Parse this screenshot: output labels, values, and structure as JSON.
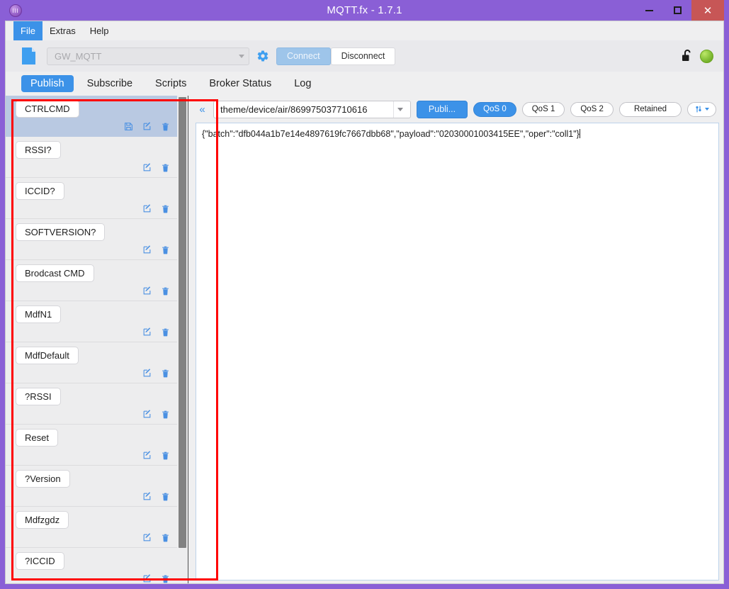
{
  "window": {
    "title": "MQTT.fx - 1.7.1",
    "app_icon": "mqtt-globe-icon",
    "controls": {
      "minimize": "minimize-icon",
      "maximize": "maximize-icon",
      "close": "✕"
    }
  },
  "menubar": {
    "items": [
      {
        "label": "File",
        "active": true
      },
      {
        "label": "Extras",
        "active": false
      },
      {
        "label": "Help",
        "active": false
      }
    ]
  },
  "connection_toolbar": {
    "doc_icon": "new-file-icon",
    "broker_profile": "GW_MQTT",
    "gear_icon": "settings-gear-icon",
    "connect_label": "Connect",
    "disconnect_label": "Disconnect",
    "lock_icon": "unlocked-padlock-icon",
    "status_led": "connected-green-led",
    "led_color": "#8cc63f"
  },
  "tabs": [
    {
      "label": "Publish",
      "active": true
    },
    {
      "label": "Subscribe",
      "active": false
    },
    {
      "label": "Scripts",
      "active": false
    },
    {
      "label": "Broker Status",
      "active": false
    },
    {
      "label": "Log",
      "active": false
    }
  ],
  "command_list": {
    "items": [
      {
        "label": "CTRLCMD",
        "selected": true,
        "has_save": true
      },
      {
        "label": "RSSI?",
        "selected": false,
        "has_save": false
      },
      {
        "label": "ICCID?",
        "selected": false,
        "has_save": false
      },
      {
        "label": "SOFTVERSION?",
        "selected": false,
        "has_save": false
      },
      {
        "label": "Brodcast CMD",
        "selected": false,
        "has_save": false
      },
      {
        "label": "MdfN1",
        "selected": false,
        "has_save": false
      },
      {
        "label": "MdfDefault",
        "selected": false,
        "has_save": false
      },
      {
        "label": "?RSSI",
        "selected": false,
        "has_save": false
      },
      {
        "label": "Reset",
        "selected": false,
        "has_save": false
      },
      {
        "label": "?Version",
        "selected": false,
        "has_save": false
      },
      {
        "label": "Mdfzgdz",
        "selected": false,
        "has_save": false
      },
      {
        "label": "?ICCID",
        "selected": false,
        "has_save": false
      }
    ],
    "icons": {
      "save": "save-icon",
      "edit": "edit-pencil-icon",
      "delete": "trash-delete-icon"
    },
    "selected_bg": "#b9c9e2"
  },
  "publish_toolbar": {
    "collapse_icon": "collapse-left-chevrons-icon",
    "topic": "theme/device/air/869975037710616",
    "publish_label": "Publi...",
    "qos": [
      {
        "label": "QoS 0",
        "active": true
      },
      {
        "label": "QoS 1",
        "active": false
      },
      {
        "label": "QoS 2",
        "active": false
      }
    ],
    "retained_label": "Retained",
    "options_icon": "publish-options-gear-icon"
  },
  "payload": {
    "text": "{\"batch\":\"dfb044a1b7e14e4897619fc7667dbb68\",\"payload\":\"02030001003415EE\",\"oper\":\"coll1\"}"
  },
  "annotation": {
    "color": "#ff0000",
    "shape": "rectangle"
  },
  "theme": {
    "title_bar": "#8a5fd6",
    "accent_blue": "#3c92e8",
    "close_red": "#c75656",
    "panel_bg": "#efeff0"
  }
}
